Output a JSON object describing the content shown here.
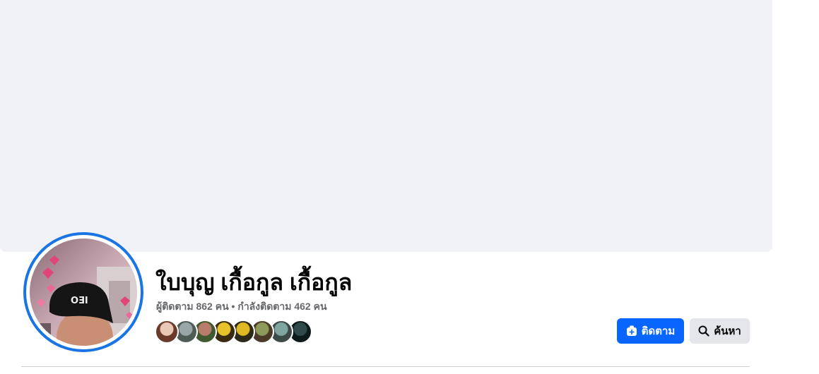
{
  "profile": {
    "name": "ใบบุญ เกื้อกูล เกื้อกูล",
    "followers_text": "ผู้ติดตาม 862 คน",
    "separator": " • ",
    "following_text": "กำลังติดตาม 462 คน"
  },
  "buttons": {
    "follow_label": "ติดตาม",
    "search_label": "ค้นหา"
  },
  "icons": {
    "follow": "follow-plus-icon",
    "search": "search-icon"
  },
  "colors": {
    "primary": "#0866ff",
    "ring": "#1b74e4",
    "cover": "#f0f2f5",
    "secondary_button": "#e4e6eb",
    "muted_text": "#65676b"
  },
  "friend_avatars": [
    {
      "name": "friend-avatar-1",
      "colors": [
        "#e8c9b8",
        "#6b3a2a"
      ]
    },
    {
      "name": "friend-avatar-2",
      "colors": [
        "#9aa7a9",
        "#4f5b55"
      ]
    },
    {
      "name": "friend-avatar-3",
      "colors": [
        "#b77c6a",
        "#3f5a2f"
      ]
    },
    {
      "name": "friend-avatar-4",
      "colors": [
        "#e8c22c",
        "#3b2a12"
      ]
    },
    {
      "name": "friend-avatar-5",
      "colors": [
        "#e0b823",
        "#2d2a1a"
      ]
    },
    {
      "name": "friend-avatar-6",
      "colors": [
        "#8d9a5a",
        "#4a3a28"
      ]
    },
    {
      "name": "friend-avatar-7",
      "colors": [
        "#7fa7a0",
        "#3e4a48"
      ]
    },
    {
      "name": "friend-avatar-8",
      "colors": [
        "#2f4a4a",
        "#0d1a1a"
      ]
    }
  ]
}
